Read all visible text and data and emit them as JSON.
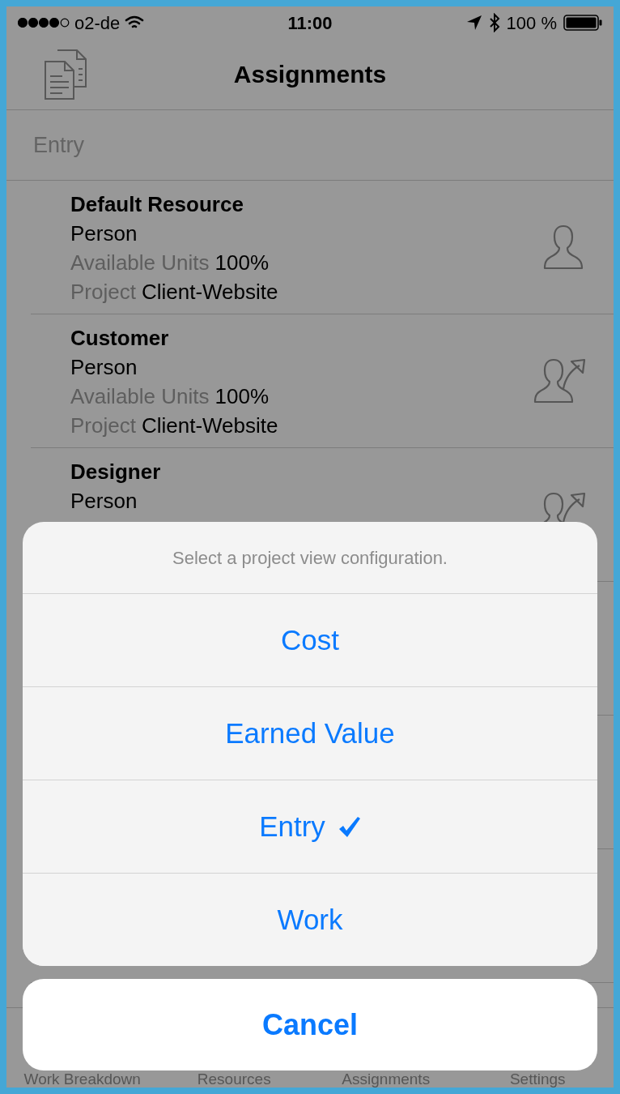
{
  "status_bar": {
    "carrier": "o2-de",
    "time": "11:00",
    "battery": "100 %"
  },
  "nav_bar": {
    "title": "Assignments"
  },
  "section_header": "Entry",
  "resources": [
    {
      "name": "Default Resource",
      "type": "Person",
      "units_label": "Available Units",
      "units": "100%",
      "project_label": "Project",
      "project": "Client-Website",
      "kind": "person"
    },
    {
      "name": "Customer",
      "type": "Person",
      "units_label": "Available Units",
      "units": "100%",
      "project_label": "Project",
      "project": "Client-Website",
      "kind": "shared"
    },
    {
      "name": "Designer",
      "type": "Person",
      "kind": "shared"
    }
  ],
  "action_sheet": {
    "title": "Select a project view configuration.",
    "options": [
      {
        "label": "Cost",
        "selected": false
      },
      {
        "label": "Earned Value",
        "selected": false
      },
      {
        "label": "Entry",
        "selected": true
      },
      {
        "label": "Work",
        "selected": false
      }
    ],
    "cancel": "Cancel"
  },
  "tab_bar": {
    "tabs": [
      "Work Breakdown",
      "Resources",
      "Assignments",
      "Settings"
    ]
  }
}
